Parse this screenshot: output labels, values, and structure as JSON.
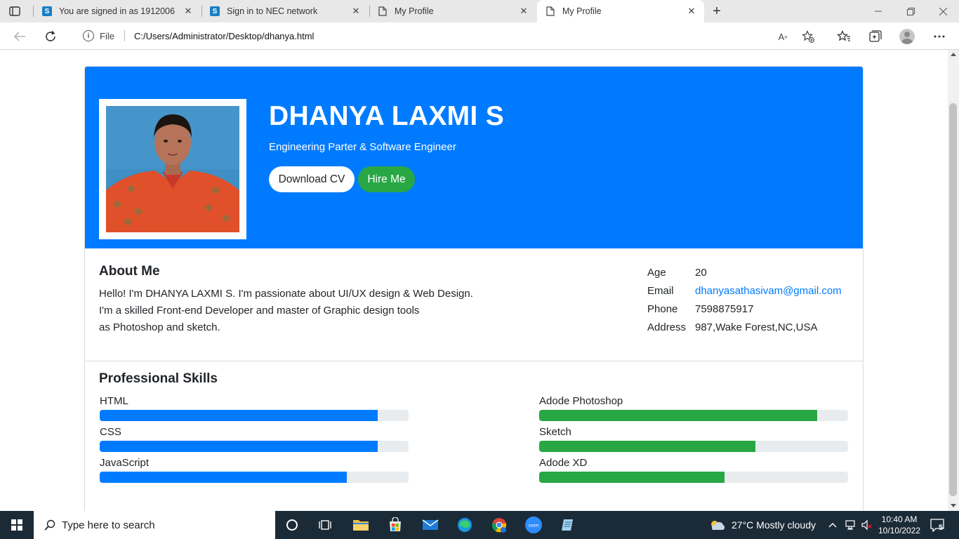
{
  "browser": {
    "tabs": [
      {
        "title": "You are signed in as 1912006",
        "favicon": "s-icon"
      },
      {
        "title": "Sign in to NEC network",
        "favicon": "s-icon"
      },
      {
        "title": "My Profile",
        "favicon": "page-icon"
      },
      {
        "title": "My Profile",
        "favicon": "page-icon"
      }
    ],
    "active_tab": 3,
    "address": {
      "scheme_label": "File",
      "url": "C:/Users/Administrator/Desktop/dhanya.html"
    }
  },
  "profile": {
    "name": "DHANYA LAXMI S",
    "subtitle": "Engineering Parter & Software Engineer",
    "download_label": "Download CV",
    "hire_label": "Hire Me"
  },
  "about": {
    "title": "About Me",
    "lines": [
      "Hello! I'm DHANYA LAXMI S. I'm passionate about UI/UX design & Web Design.",
      "I'm a skilled Front-end Developer and master of Graphic design tools",
      "as Photoshop and sketch."
    ],
    "info": [
      {
        "key": "Age",
        "value": "20"
      },
      {
        "key": "Email",
        "value": "dhanyasathasivam@gmail.com",
        "link": true
      },
      {
        "key": "Phone",
        "value": "7598875917"
      },
      {
        "key": "Address",
        "value": "987,Wake Forest,NC,USA"
      }
    ]
  },
  "skills": {
    "title": "Professional Skills",
    "left": [
      {
        "label": "HTML",
        "level": 0.9
      },
      {
        "label": "CSS",
        "level": 0.9
      },
      {
        "label": "JavaScript",
        "level": 0.8
      }
    ],
    "right": [
      {
        "label": "Adode Photoshop",
        "level": 0.9
      },
      {
        "label": "Sketch",
        "level": 0.7
      },
      {
        "label": "Adode XD",
        "level": 0.6
      }
    ],
    "left_color": "#007bff",
    "right_color": "#28a745"
  },
  "taskbar": {
    "search_placeholder": "Type here to search",
    "weather": "27°C  Mostly cloudy",
    "time": "10:40 AM",
    "date": "10/10/2022",
    "notification_count": "5"
  },
  "colors": {
    "primary": "#007bff",
    "success": "#28a745",
    "taskbar": "#1b2a37"
  }
}
